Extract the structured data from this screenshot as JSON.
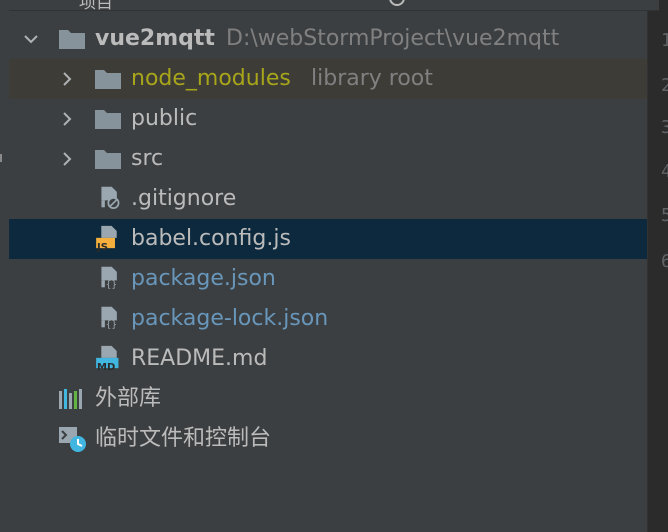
{
  "top_bar": {
    "title": "项目"
  },
  "tree": {
    "root": {
      "name": "vue2mqtt",
      "path": "D:\\webStormProject\\vue2mqtt"
    },
    "folders": [
      {
        "name": "node_modules",
        "hint": "library root",
        "color": "#a7a51a",
        "excluded": true
      },
      {
        "name": "public",
        "hint": "",
        "color": "#bbbbbb",
        "excluded": false
      },
      {
        "name": "src",
        "hint": "",
        "color": "#bbbbbb",
        "excluded": false
      }
    ],
    "files": [
      {
        "name": ".gitignore",
        "icon": "gitignore-file-icon",
        "color": "#bbbbbb",
        "selected": false
      },
      {
        "name": "babel.config.js",
        "icon": "js-file-icon",
        "badge": "JS",
        "color": "#bbbbbb",
        "selected": true
      },
      {
        "name": "package.json",
        "icon": "json-file-icon",
        "color": "#6897bb",
        "selected": false
      },
      {
        "name": "package-lock.json",
        "icon": "json-file-icon",
        "color": "#6897bb",
        "selected": false
      },
      {
        "name": "README.md",
        "icon": "md-file-icon",
        "badge": "MD",
        "color": "#bbbbbb",
        "selected": false
      }
    ],
    "external_libraries": {
      "label": "外部库"
    },
    "scratches": {
      "label": "临时文件和控制台"
    }
  },
  "colors": {
    "panel_bg": "#3c3f41",
    "selected_bg": "#0d293e",
    "excluded_bg": "#3e3c37",
    "folder_icon": "#87939a",
    "link_blue": "#6897bb"
  },
  "gutter": {
    "line_numbers": [
      "1",
      "2",
      "3",
      "4",
      "5",
      "6"
    ]
  }
}
